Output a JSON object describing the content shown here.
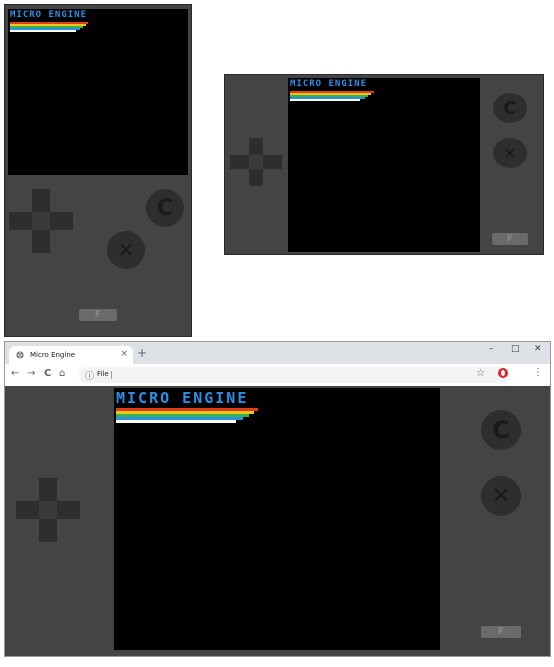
{
  "app_title": "MICRO ENGINE",
  "f_button_label": "F",
  "c_button_label": "C",
  "x_button_label": "✕",
  "stripe_colors": [
    "#e03c1e",
    "#f0c419",
    "#38b24a",
    "#2a8fe6",
    "#ffffff"
  ],
  "browser": {
    "tab_title": "Micro Engine",
    "tab_close": "×",
    "new_tab": "+",
    "minimize": "–",
    "maximize": "□",
    "close": "✕",
    "back": "←",
    "forward": "→",
    "reload": "C",
    "home": "⌂",
    "address_scheme": "File",
    "info_icon": "ⓘ",
    "star": "☆",
    "menu": "⋮"
  }
}
